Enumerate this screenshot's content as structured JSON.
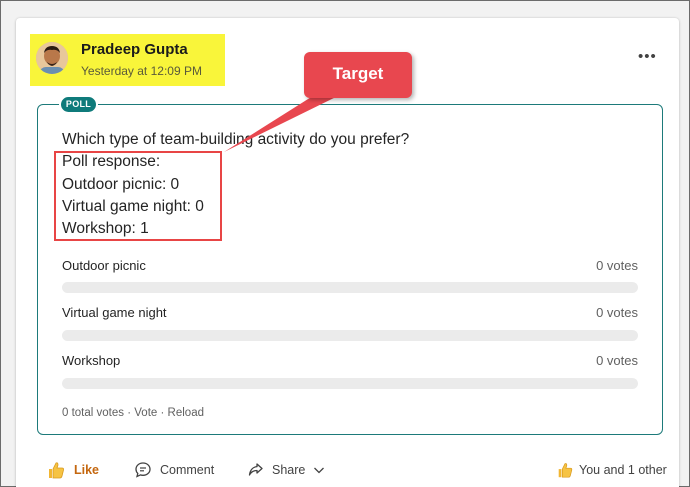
{
  "post": {
    "author_name": "Pradeep Gupta",
    "timestamp": "Yesterday at 12:09 PM",
    "more_icon": "more-horizontal-icon"
  },
  "poll": {
    "tag": "POLL",
    "question": "Which type of team-building activity do you prefer?",
    "response_lines": [
      "Poll response:",
      "Outdoor picnic: 0",
      "Virtual game night: 0",
      "Workshop: 1"
    ],
    "options": [
      {
        "label": "Outdoor picnic",
        "votes": "0 votes",
        "fraction": 0
      },
      {
        "label": "Virtual game night",
        "votes": "0 votes",
        "fraction": 0
      },
      {
        "label": "Workshop",
        "votes": "0 votes",
        "fraction": 0
      }
    ],
    "total_votes": "0 total votes",
    "separator": "·",
    "vote_link": "Vote",
    "reload_link": "Reload",
    "accent_color": "#0f7b7b"
  },
  "annotation": {
    "callout_label": "Target",
    "color": "#e8474f"
  },
  "actions": {
    "like_label": "Like",
    "comment_label": "Comment",
    "share_label": "Share",
    "reactors_label": "You and 1 other"
  }
}
